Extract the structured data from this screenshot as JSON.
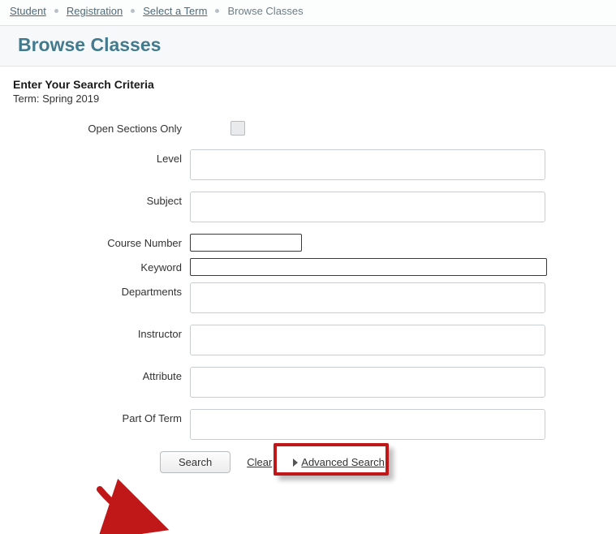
{
  "breadcrumb": {
    "items": [
      "Student",
      "Registration",
      "Select a Term",
      "Browse Classes"
    ],
    "current_index": 3
  },
  "page": {
    "title": "Browse Classes"
  },
  "search": {
    "heading": "Enter Your Search Criteria",
    "term_prefix": "Term: ",
    "term_value": "Spring 2019",
    "fields": {
      "open_sections": "Open Sections Only",
      "level": "Level",
      "subject": "Subject",
      "course_number": "Course Number",
      "keyword": "Keyword",
      "departments": "Departments",
      "instructor": "Instructor",
      "attribute": "Attribute",
      "part_of_term": "Part Of Term"
    },
    "values": {
      "course_number": "",
      "keyword": ""
    },
    "buttons": {
      "search": "Search",
      "clear": "Clear",
      "advanced": "Advanced Search"
    }
  }
}
